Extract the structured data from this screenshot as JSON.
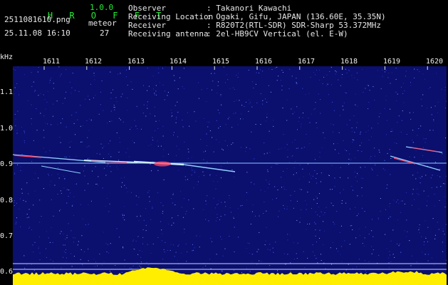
{
  "app": {
    "name": "H R O F F T",
    "version": "1.0.0"
  },
  "file": {
    "name": "2511081610.png",
    "datetime": "25.11.08 16:10"
  },
  "meteor": {
    "label": "meteor",
    "count": "27"
  },
  "info": [
    {
      "key": "Observer",
      "value": ": Takanori Kawachi"
    },
    {
      "key": "Receiving Location",
      "value": ": Ogaki, Gifu, JAPAN (136.60E, 35.35N)"
    },
    {
      "key": "Receiver",
      "value": ": R820T2(RTL-SDR) SDR-Sharp 53.372MHz"
    },
    {
      "key": "Receiving antenna",
      "value": ": 2el-HB9CV Vertical (el. E-W)"
    }
  ],
  "axis": {
    "y_unit": "kHz",
    "y_ticks": [
      "1.1",
      "1.0",
      "0.9",
      "0.8",
      "0.7",
      "0.6"
    ],
    "x_ticks": [
      "1611",
      "1612",
      "1613",
      "1614",
      "1615",
      "1616",
      "1617",
      "1618",
      "1619",
      "1620"
    ]
  },
  "colors": {
    "background": "#000000",
    "plot": "#0b0f6e",
    "title_green": "#22ee33",
    "echo_cyan": "#8fd0ff",
    "echo_red": "#ff4466",
    "level_yellow": "#ffee00",
    "level_cyan": "#00e5ff"
  }
}
